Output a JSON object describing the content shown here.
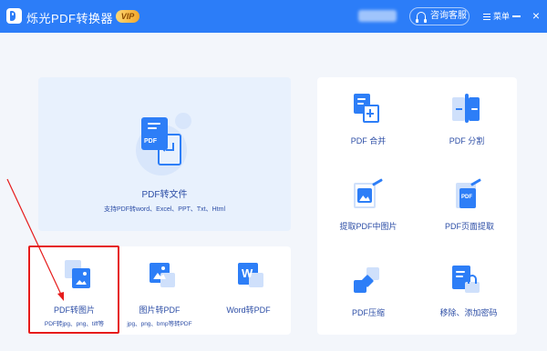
{
  "app": {
    "title": "烁光PDF转换器",
    "vip_badge": "VIP"
  },
  "header": {
    "service_label": "咨询客服",
    "menu_label": "菜单",
    "close_symbol": "×"
  },
  "hero": {
    "title": "PDF转文件",
    "subtitle": "支持PDF转word、Excel、PPT、Txt、Html",
    "icon_text": "PDF"
  },
  "bottom_tools": [
    {
      "label": "PDF转图片",
      "sub": "PDF转jpg、png、tiff等"
    },
    {
      "label": "图片转PDF",
      "sub": "jpg、png、bmp等转PDF"
    },
    {
      "label": "Word转PDF",
      "sub": ""
    }
  ],
  "right_tools": [
    {
      "label": "PDF 合并"
    },
    {
      "label": "PDF 分割"
    },
    {
      "label": "提取PDF中图片"
    },
    {
      "label": "PDF页面提取"
    },
    {
      "label": "PDF压缩"
    },
    {
      "label": "移除、添加密码"
    }
  ],
  "colors": {
    "brand": "#2c7df8",
    "highlight": "#e61b1b"
  }
}
